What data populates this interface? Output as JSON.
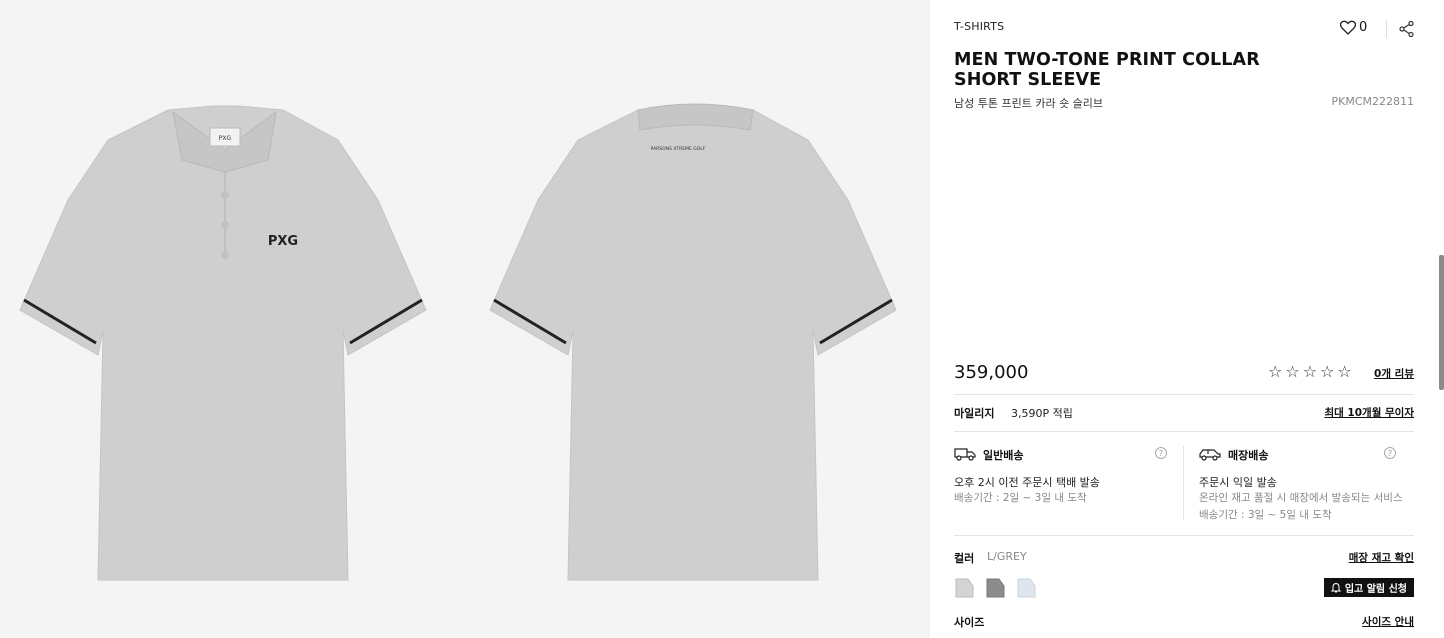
{
  "gallery": {
    "front_logo": "PXG",
    "back_print": "PARSONS XTREME GOLF",
    "shirt_color": "#cfcfcf"
  },
  "product": {
    "category": "T-SHIRTS",
    "title_line1": "MEN TWO-TONE PRINT COLLAR",
    "title_line2": "SHORT SLEEVE",
    "korean_name": "남성 투톤 프린트 카라 숏 슬리브",
    "code": "PKMCM222811",
    "wish_count": "0",
    "price": "359,000",
    "rating_stars": 0,
    "review_link": "0개 리뷰"
  },
  "mileage": {
    "label": "마일리지",
    "value": "3,590P 적립",
    "installment_link": "최대 10개월 무이자"
  },
  "shipping": {
    "standard": {
      "title": "일반배송",
      "line1": "오후 2시 이전 주문시 택배 발송",
      "line2": "배송기간 : 2일 ~ 3일 내 도착"
    },
    "store": {
      "title": "매장배송",
      "line1": "주문시 익일 발송",
      "line2": "온라인 재고 품절 시 매장에서 발송되는 서비스",
      "line3": "배송기간 : 3일 ~ 5일 내 도착"
    },
    "help_symbol": "?"
  },
  "color": {
    "label": "컬러",
    "value": "L/GREY",
    "stock_link": "매장 재고 확인",
    "swatches": [
      "#d4d4d4",
      "#8c8c8c",
      "#dfe5ec"
    ]
  },
  "restock_button": "입고 알림 신청",
  "size": {
    "label": "사이즈",
    "guide_link": "사이즈 안내"
  },
  "icons": {
    "wish": "heart-icon",
    "share": "share-icon",
    "standard_ship": "truck-icon",
    "store_ship": "car-icon",
    "restock": "bell-icon"
  }
}
